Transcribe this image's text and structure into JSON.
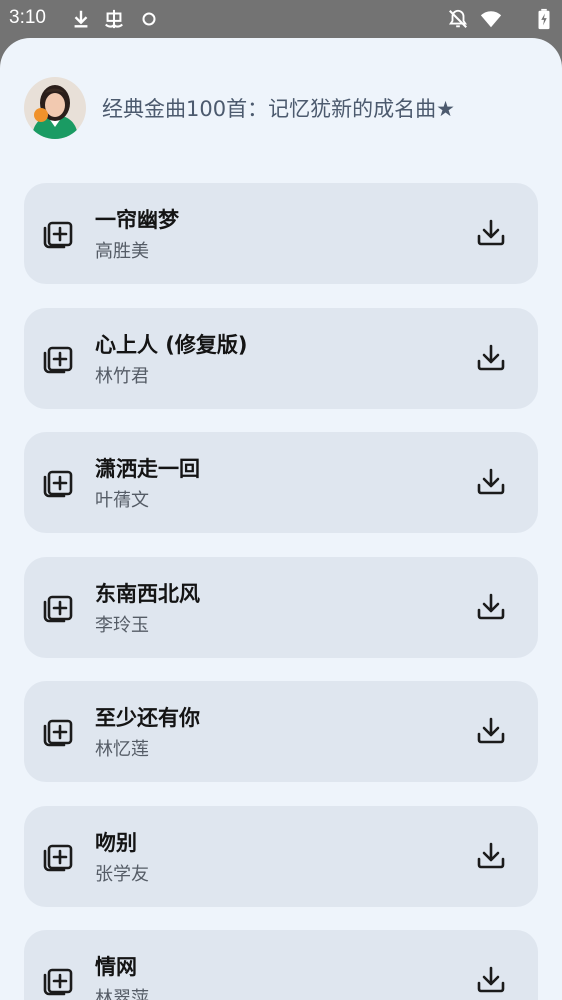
{
  "status_bar": {
    "time": "3:10",
    "icons": [
      "download-icon",
      "bug-icon",
      "circle-icon",
      "notifications-off-icon",
      "wifi-icon",
      "battery-charging-icon"
    ]
  },
  "playlist": {
    "title": "经典金曲100首：记忆犹新的成名曲★",
    "avatar": "avatar"
  },
  "songs": [
    {
      "title": "一帘幽梦",
      "artist": "高胜美"
    },
    {
      "title": "心上人 (修复版)",
      "artist": "林竹君"
    },
    {
      "title": "潇洒走一回",
      "artist": "叶蒨文"
    },
    {
      "title": "东南西北风",
      "artist": "李玲玉"
    },
    {
      "title": "至少还有你",
      "artist": "林忆莲"
    },
    {
      "title": "吻别",
      "artist": "张学友"
    },
    {
      "title": "情网",
      "artist": "林翠萍"
    }
  ],
  "colors": {
    "status_bar": "#737373",
    "background": "#eef4fb",
    "card": "#dfe6ef",
    "title_text": "#141414",
    "artist_text": "#555c66",
    "header_text": "#4c5a6e"
  }
}
